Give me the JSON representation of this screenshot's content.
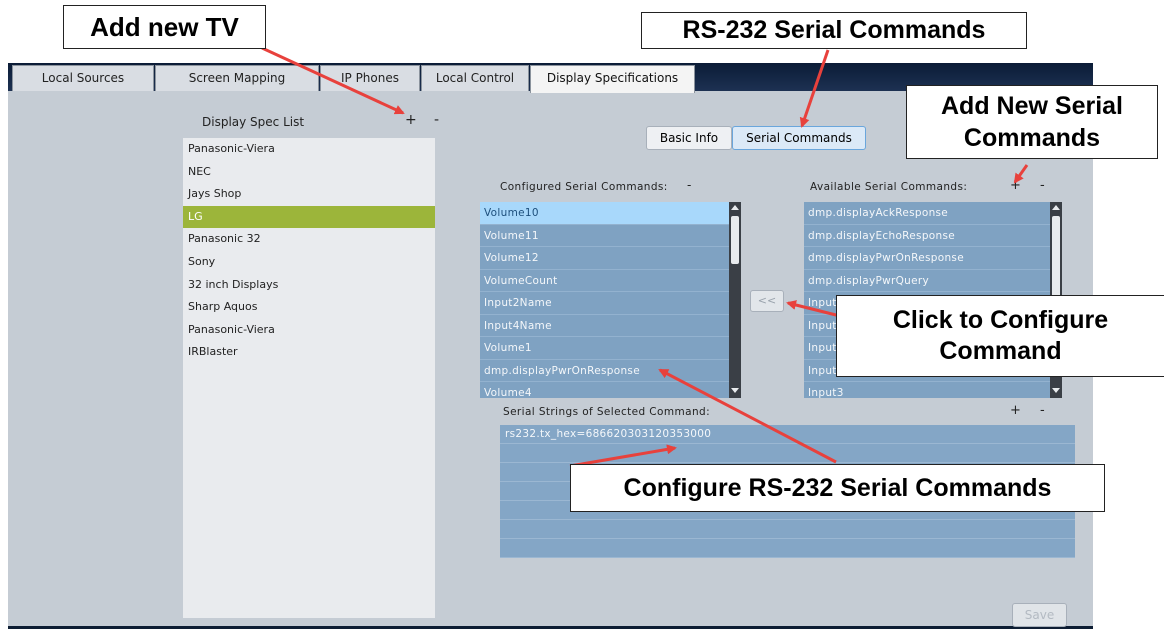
{
  "tabs": [
    {
      "label": "Local Sources"
    },
    {
      "label": "Screen Mapping"
    },
    {
      "label": "IP Phones"
    },
    {
      "label": "Local Control"
    },
    {
      "label": "Display Specifications"
    }
  ],
  "spec_list": {
    "title": "Display Spec List",
    "add": "+",
    "remove": "-",
    "items": [
      "Panasonic-Viera",
      "NEC",
      "Jays Shop",
      "LG",
      "Panasonic 32",
      "Sony",
      "32 inch Displays",
      "Sharp Aquos",
      "Panasonic-Viera",
      "IRBlaster"
    ],
    "selected_index": 3
  },
  "view_toggle": {
    "basic_info": "Basic Info",
    "serial_commands": "Serial Commands"
  },
  "configured": {
    "title": "Configured Serial Commands:",
    "remove": "-",
    "items": [
      "Volume10",
      "Volume11",
      "Volume12",
      "VolumeCount",
      "Input2Name",
      "Input4Name",
      "Volume1",
      "dmp.displayPwrOnResponse",
      "Volume4"
    ]
  },
  "available": {
    "title": "Available Serial Commands:",
    "add": "+",
    "remove": "-",
    "items": [
      "dmp.displayAckResponse",
      "dmp.displayEchoResponse",
      "dmp.displayPwrOnResponse",
      "dmp.displayPwrQuery",
      "Input",
      "Input",
      "Input",
      "Input",
      "Input3"
    ]
  },
  "move_button": "<<",
  "serial_strings": {
    "title": "Serial Strings of Selected Command:",
    "add": "+",
    "remove": "-",
    "rows": [
      "rs232.tx_hex=686620303120353000",
      "",
      "",
      "",
      "",
      "",
      ""
    ]
  },
  "save_button": "Save",
  "callouts": {
    "add_tv": "Add new TV",
    "rs232": "RS-232 Serial Commands",
    "add_serial_line1": "Add New Serial",
    "add_serial_line2": "Commands",
    "click_configure_line1": "Click to Configure",
    "click_configure_line2": "Command",
    "configure_rs232": "Configure RS-232 Serial Commands"
  },
  "colors": {
    "arrow": "#e8413c",
    "selected_spec": "#9cb53a",
    "list_bg": "#7fa2c2"
  }
}
